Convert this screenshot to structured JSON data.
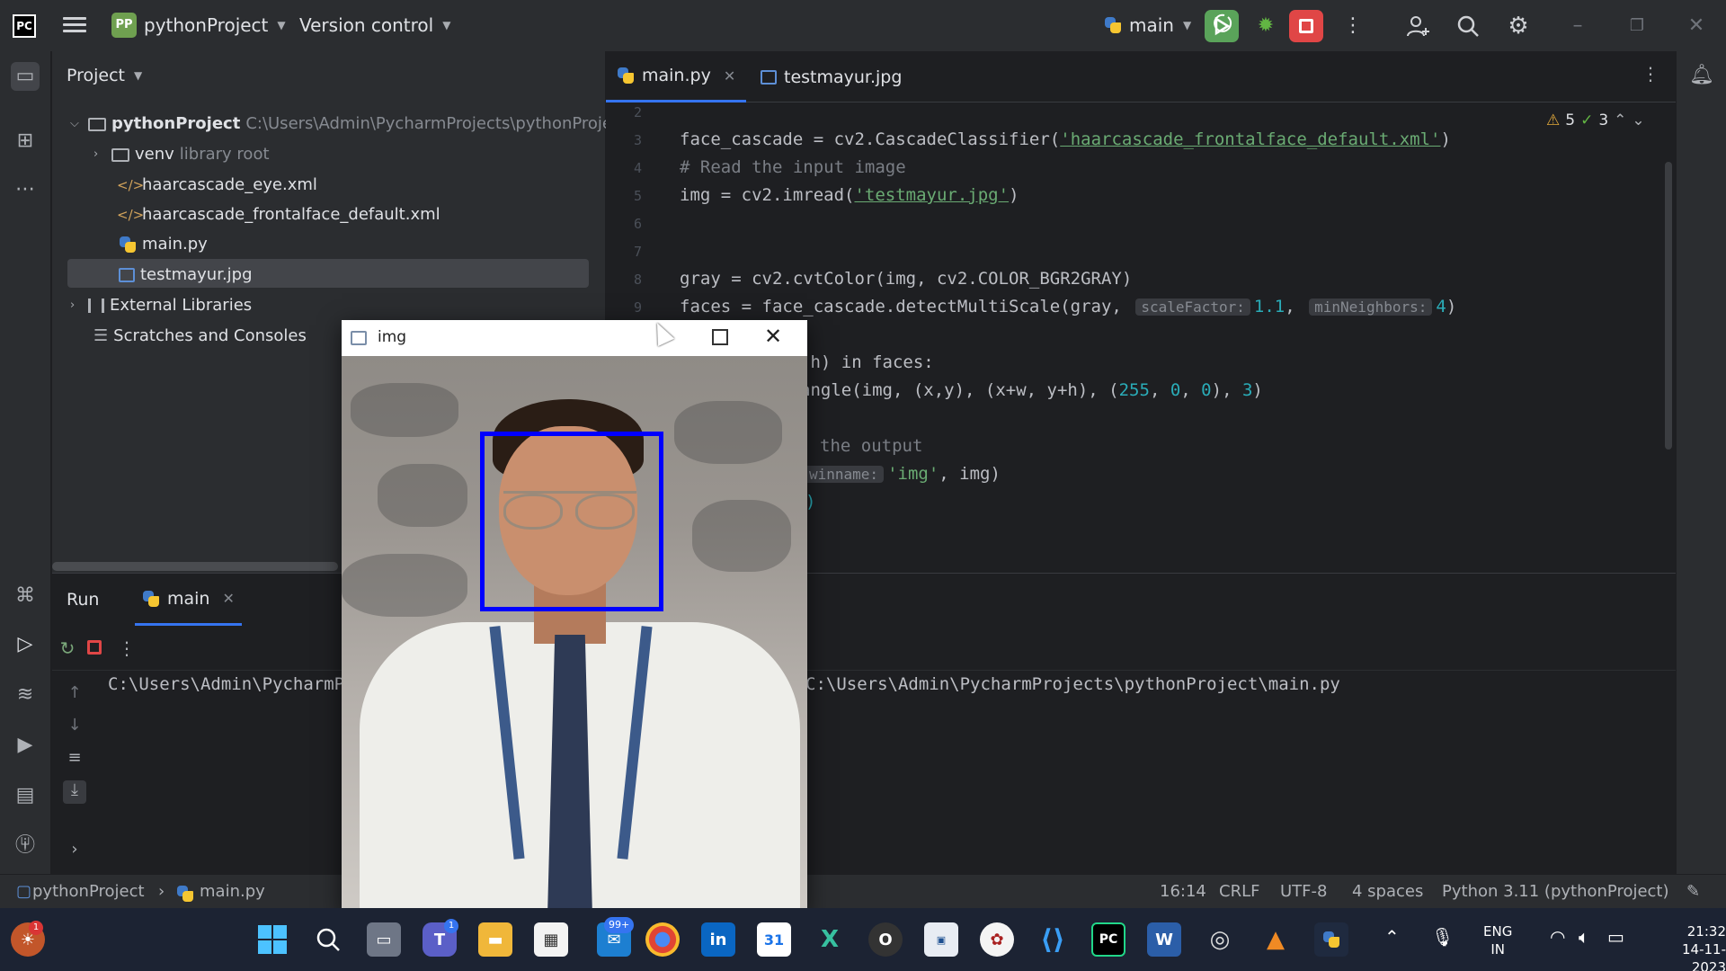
{
  "titlebar": {
    "logo": "PC",
    "project_badge": "PP",
    "project_name": "pythonProject",
    "vcs": "Version control",
    "run_config": "main"
  },
  "project_panel": {
    "title": "Project",
    "root_name": "pythonProject",
    "root_path": "C:\\Users\\Admin\\PycharmProjects\\pythonProje",
    "venv": "venv",
    "venv_note": "library root",
    "files": [
      "haarcascade_eye.xml",
      "haarcascade_frontalface_default.xml",
      "main.py",
      "testmayur.jpg"
    ],
    "external": "External Libraries",
    "scratches": "Scratches and Consoles"
  },
  "editor": {
    "tabs": [
      "main.py",
      "testmayur.jpg"
    ],
    "line_numbers": [
      "2",
      "3",
      "4",
      "5",
      "6",
      "7",
      "8",
      "9"
    ],
    "inspections": {
      "warnings": "5",
      "ok": "3"
    },
    "code": {
      "l3_a": "face_cascade = cv2.CascadeClassifier(",
      "l3_str": "'haarcascade_frontalface_default.xml'",
      "l3_b": ")",
      "l4": "# Read the input image",
      "l5_a": "img = cv2.imread(",
      "l5_str": "'testmayur.jpg'",
      "l5_b": ")",
      "l8": "gray = cv2.cvtColor(img, cv2.COLOR_BGR2GRAY)",
      "l9_a": "faces = face_cascade.detectMultiScale(gray, ",
      "l9_hint1": "scaleFactor:",
      "l9_v1": "1.1",
      "l9_hint2": "minNeighbors:",
      "l9_v2": "4",
      "l9_b": ")",
      "l11": ",h) in faces:",
      "l12_a": "angle(img, (x,y), (x+w, y+h), (",
      "l12_n1": "255",
      "l12_n2": "0",
      "l12_n3": "0",
      "l12_n4": "3",
      "l14": "the output",
      "l15_hint": "winname:",
      "l15_str": "'img'",
      "l15_b": ", img)",
      "l16": ")"
    }
  },
  "run": {
    "title": "Run",
    "tab": "main",
    "console_left": "C:\\Users\\Admin\\PycharmP",
    "console_right": "C:\\Users\\Admin\\PycharmProjects\\pythonProject\\main.py"
  },
  "image_window": {
    "title": "img",
    "box_color": "#0000ff"
  },
  "statusbar": {
    "crumb_project": "pythonProject",
    "crumb_file": "main.py",
    "position": "16:14",
    "line_sep": "CRLF",
    "encoding": "UTF-8",
    "indent": "4 spaces",
    "interpreter": "Python 3.11 (pythonProject)"
  },
  "taskbar": {
    "badge_left": "1",
    "badge_teams": "1",
    "badge_store": "99+",
    "calendar": "31",
    "lang": "ENG",
    "region": "IN",
    "time": "21:32",
    "date": "14-11-2023"
  },
  "colors": {
    "accent": "#3574f0",
    "run_green": "#5aa35a",
    "stop_red": "#e04646"
  }
}
